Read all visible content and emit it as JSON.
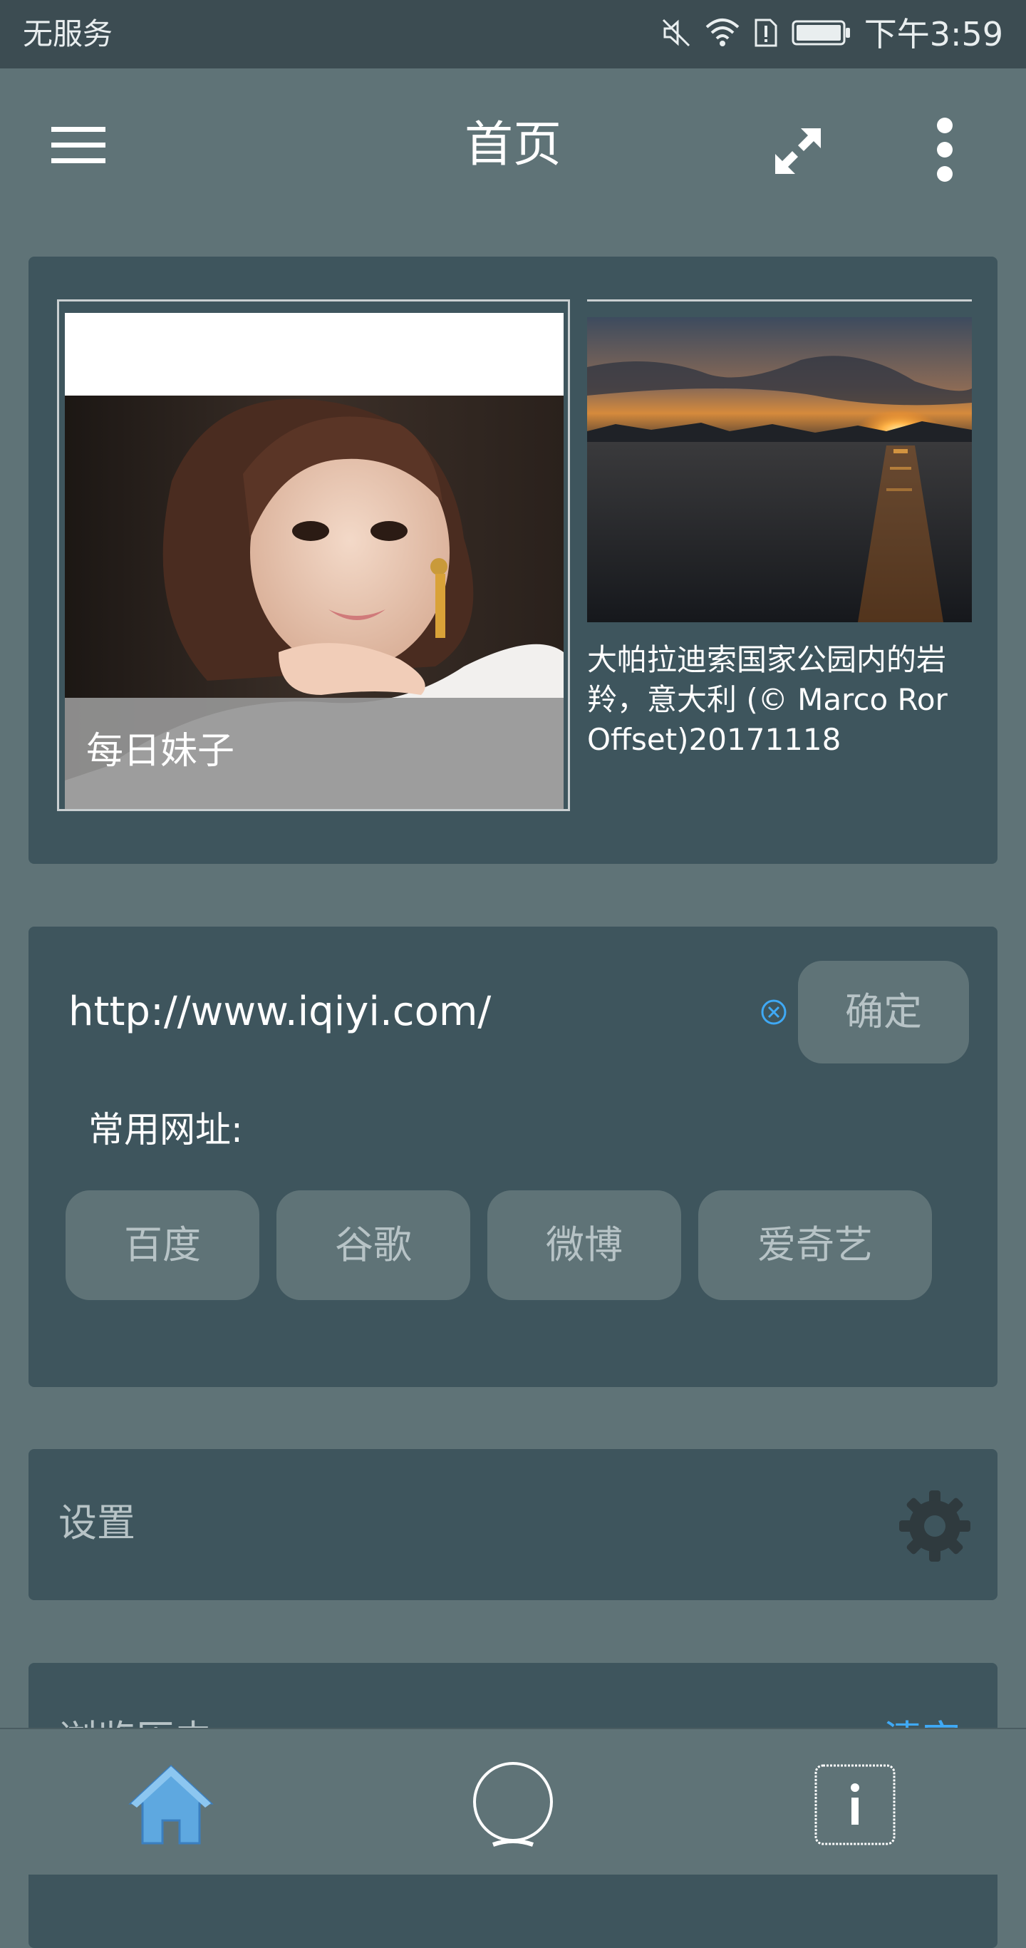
{
  "status_bar": {
    "carrier": "无服务",
    "time": "下午3:59",
    "icons": [
      "mute-icon",
      "wifi-icon",
      "sim-alert-icon",
      "battery-icon"
    ]
  },
  "toolbar": {
    "title": "首页",
    "menu_icon": "menu-icon",
    "fullscreen_icon": "fullscreen-icon",
    "more_icon": "more-vert-icon"
  },
  "gallery": {
    "items": [
      {
        "caption": "每日妹子"
      },
      {
        "caption": "大帕拉迪索国家公园内的岩羚，意大利 (© Marco Ror\nOffset)20171118"
      }
    ]
  },
  "url_panel": {
    "url_value": "http://www.iqiyi.com/",
    "confirm_label": "确定",
    "frequent_label": "常用网址:",
    "frequent_sites": [
      "百度",
      "谷歌",
      "微博",
      "爱奇艺"
    ]
  },
  "settings": {
    "label": "设置"
  },
  "history": {
    "label": "浏览历史",
    "clear_label": "清空"
  },
  "bottom_nav": {
    "items": [
      "home-icon",
      "browser-icon",
      "info-icon"
    ]
  },
  "colors": {
    "background": "#5f7377",
    "card": "#3e555d",
    "status_bar": "#3c4c52",
    "accent": "#3fa9f5",
    "home_accent": "#5ea8e0"
  }
}
